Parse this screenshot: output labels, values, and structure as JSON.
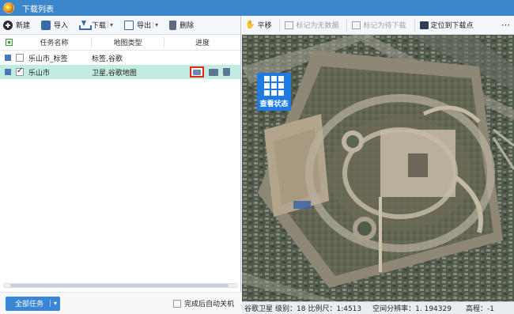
{
  "window": {
    "title": "下载列表"
  },
  "toolbar": {
    "new_label": "新建",
    "import_label": "导入",
    "download_label": "下载",
    "export_label": "导出",
    "delete_label": "删除"
  },
  "table": {
    "columns": [
      "任务名称",
      "地图类型",
      "进度"
    ],
    "rows": [
      {
        "name": "乐山市_标签",
        "type": "标签,谷歌",
        "checked": false,
        "selected": false
      },
      {
        "name": "乐山市",
        "type": "卫星,谷歌地图",
        "checked": true,
        "selected": true
      }
    ]
  },
  "bottom": {
    "all_tasks_label": "全部任务",
    "auto_shutdown_label": "完成后自动关机"
  },
  "map_toolbar": {
    "pan_label": "平移",
    "mark_no_data_label": "标记为无数据",
    "mark_pending_label": "标记为待下载",
    "locate_label": "定位到下载点"
  },
  "map": {
    "status_button_label": "查看状态"
  },
  "statusbar": {
    "source": "谷歌卫星",
    "level": "级别：18",
    "scale": "比例尺：1:4513",
    "resolution": "空间分辨率：1. 194329",
    "elevation": "高程：-1"
  },
  "colors": {
    "titlebar": "#3c86cb",
    "selected_row": "#c2ece2",
    "status_button": "#1f7be1",
    "highlight_border": "#e2261b"
  }
}
